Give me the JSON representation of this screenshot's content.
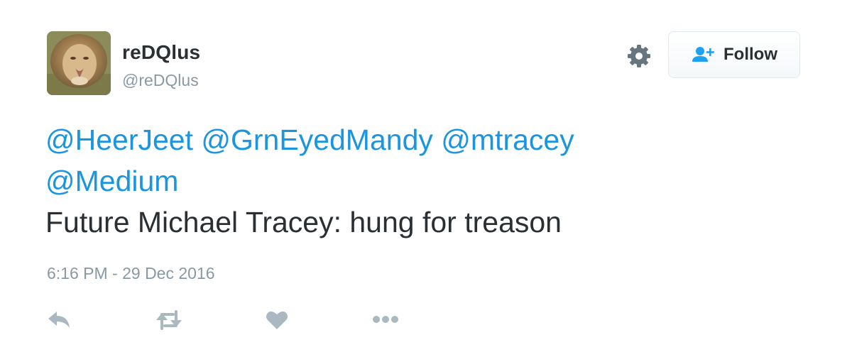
{
  "user": {
    "name": "reDQlus",
    "handle": "@reDQlus"
  },
  "follow_button": {
    "label": "Follow",
    "icon": "add-user-icon"
  },
  "settings_icon": "gear-icon",
  "tweet": {
    "mentions": [
      "@HeerJeet",
      "@GrnEyedMandy",
      "@mtracey",
      "@Medium"
    ],
    "text": "Future Michael Tracey: hung for treason",
    "timestamp": "6:16 PM - 29 Dec 2016"
  },
  "actions": [
    "reply-icon",
    "retweet-icon",
    "like-icon",
    "more-icon"
  ],
  "colors": {
    "link": "#1b95e0",
    "text": "#292f33",
    "muted": "#8899a6",
    "icon": "#aab8c2",
    "follow_icon": "#1da1f2"
  }
}
